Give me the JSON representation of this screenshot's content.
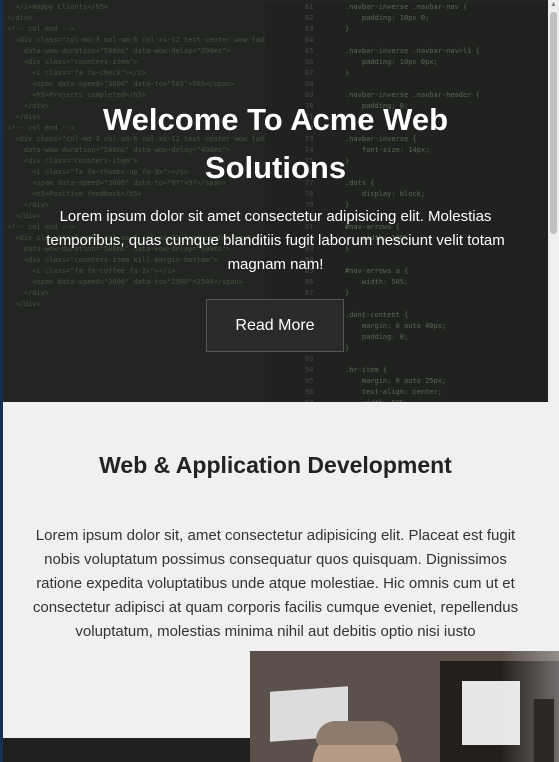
{
  "hero": {
    "title": "Welcome To Acme Web Solutions",
    "text": "Lorem ipsum dolor sit amet consectetur adipisicing elit. Molestias temporibus, quas cumque blanditiis fugit laborum nesciunt velit totam magnam nam!",
    "button_label": "Read More"
  },
  "section": {
    "title": "Web & Application Development",
    "text": "Lorem ipsum dolor sit, amet consectetur adipisicing elit. Placeat est fugit nobis voluptatum possimus consequatur quos quisquam. Dignissimos ratione expedita voluptatibus unde atque molestiae. Hic omnis cum ut et consectetur adipisci at quam corporis facilis cumque eveniet, repellendus voluptatum, molestias minima nihil aut debitis optio nisi iusto"
  },
  "colors": {
    "hero_background": "#232522",
    "section_background": "#f0f0f0",
    "button_background": "#2a2a2a",
    "footer_background": "#1f201f"
  }
}
